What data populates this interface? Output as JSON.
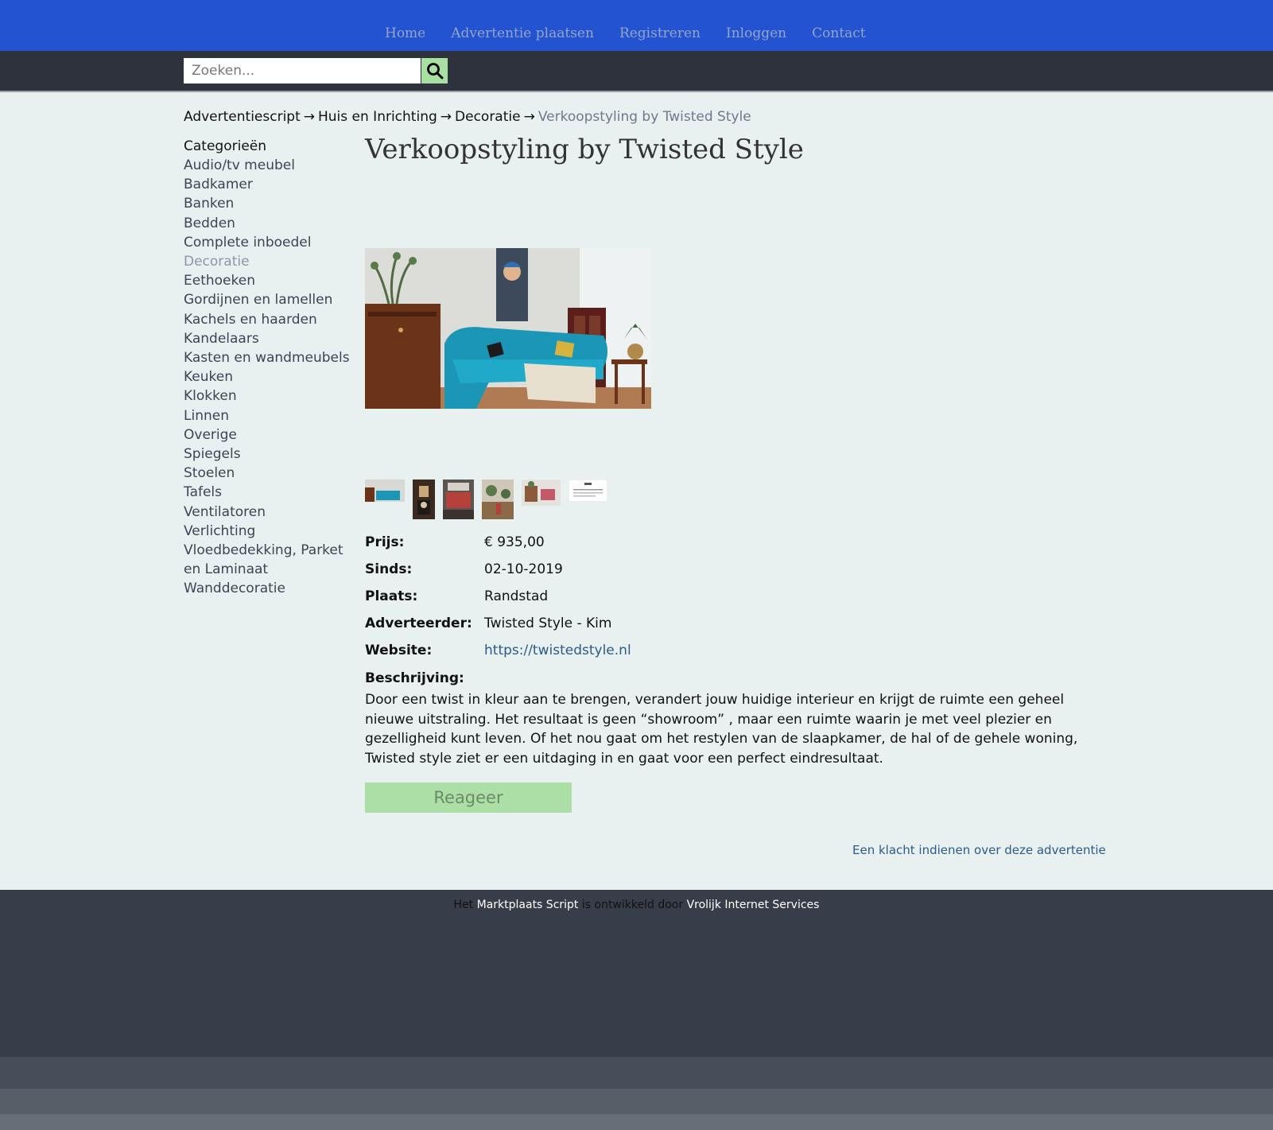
{
  "nav": {
    "items": [
      "Home",
      "Advertentie plaatsen",
      "Registreren",
      "Inloggen",
      "Contact"
    ]
  },
  "search": {
    "placeholder": "Zoeken...",
    "icon": "search-icon"
  },
  "breadcrumb": {
    "items": [
      "Advertentiescript",
      "Huis en Inrichting",
      "Decoratie"
    ],
    "separator": "→",
    "current": "Verkoopstyling by Twisted Style"
  },
  "sidebar": {
    "heading": "Categorieën",
    "categories": [
      "Audio/tv meubel",
      "Badkamer",
      "Banken",
      "Bedden",
      "Complete inboedel",
      "Decoratie",
      "Eethoeken",
      "Gordijnen en lamellen",
      "Kachels en haarden",
      "Kandelaars",
      "Kasten en wandmeubels",
      "Keuken",
      "Klokken",
      "Linnen",
      "Overige",
      "Spiegels",
      "Stoelen",
      "Tafels",
      "Ventilatoren",
      "Verlichting",
      "Vloedbedekking, Parket en Laminaat",
      "Wanddecoratie"
    ],
    "active": "Decoratie"
  },
  "listing": {
    "title": "Verkoopstyling by Twisted Style",
    "details": [
      {
        "label": "Prijs:",
        "value": "€ 935,00"
      },
      {
        "label": "Sinds:",
        "value": "02-10-2019"
      },
      {
        "label": "Plaats:",
        "value": "Randstad"
      },
      {
        "label": "Adverteerder:",
        "value": "Twisted Style - Kim"
      },
      {
        "label": "Website:",
        "value": "https://twistedstyle.nl"
      }
    ],
    "description_label": "Beschrijving:",
    "description": "Door een twist in kleur aan te brengen, verandert jouw huidige interieur en krijgt de ruimte een geheel nieuwe uitstraling. Het resultaat is geen “showroom” , maar een ruimte waarin je met veel plezier en gezelligheid kunt leven. Of het nou gaat om het restylen van de slaapkamer, de hal of de gehele woning, Twisted style ziet er een uitdaging in en gaat voor een perfect eindresultaat.",
    "reply_label": "Reageer",
    "complaint_label": "Een klacht indienen over deze advertentie"
  },
  "footer": {
    "part1": "Het",
    "link1": "Marktplaats Script",
    "part2": "is ontwikkeld door",
    "link2": "Vrolijk Internet Services"
  },
  "colors": {
    "nav_bg": "#2353d1",
    "search_bar_bg": "#2d323c",
    "page_bg": "#e8f1f0",
    "button_green": "#abdfa6",
    "link": "#2a5b8a",
    "footer_bg": "#373e4a"
  }
}
